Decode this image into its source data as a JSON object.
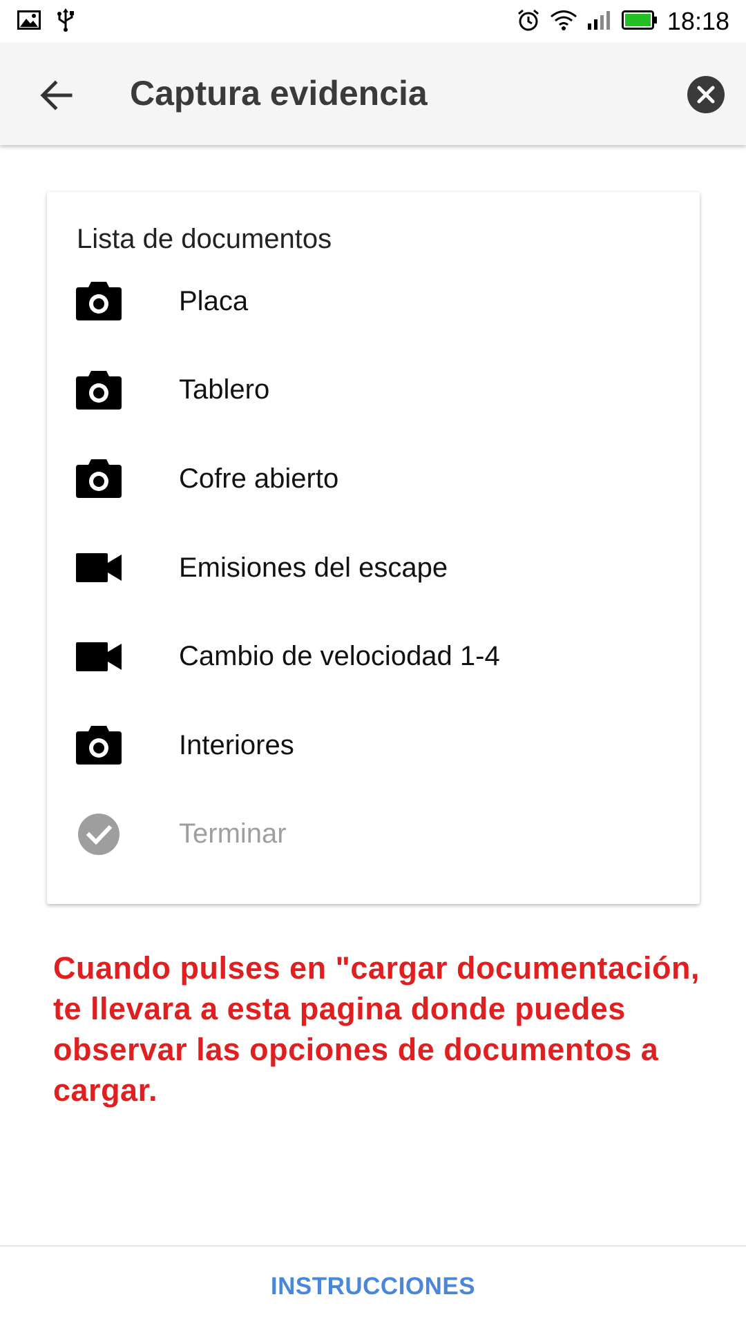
{
  "status_bar": {
    "left_icons": [
      "image-icon",
      "usb-icon"
    ],
    "right_icons": [
      "alarm-icon",
      "wifi-icon",
      "signal-icon",
      "battery-icon"
    ],
    "time": "18:18"
  },
  "app_bar": {
    "title": "Captura evidencia",
    "back_icon": "arrow-back-icon",
    "close_icon": "close-circle-icon"
  },
  "card": {
    "title": "Lista de documentos",
    "items": [
      {
        "label": "Placa",
        "icon": "camera-icon",
        "enabled": true
      },
      {
        "label": "Tablero",
        "icon": "camera-icon",
        "enabled": true
      },
      {
        "label": "Cofre abierto",
        "icon": "camera-icon",
        "enabled": true
      },
      {
        "label": "Emisiones del escape",
        "icon": "videocam-icon",
        "enabled": true
      },
      {
        "label": "Cambio de velociodad 1-4",
        "icon": "videocam-icon",
        "enabled": true
      },
      {
        "label": "Interiores",
        "icon": "camera-icon",
        "enabled": true
      },
      {
        "label": "Terminar",
        "icon": "check-circle-icon",
        "enabled": false
      }
    ]
  },
  "note": {
    "text": "Cuando pulses en \"cargar documentación, te llevara a esta pagina donde puedes observar las opciones de documentos a cargar."
  },
  "bottom": {
    "button_label": "INSTRUCCIONES"
  },
  "colors": {
    "note": "#e02020",
    "link": "#4a86d9",
    "app_bar_bg": "#f5f5f5",
    "disabled": "#9e9e9e"
  }
}
